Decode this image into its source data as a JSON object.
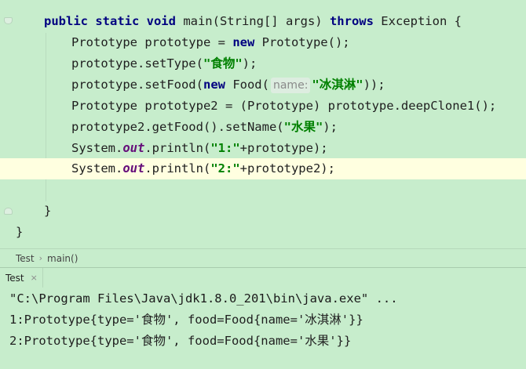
{
  "editor": {
    "lines": [
      {
        "parts": [
          {
            "t": "public static void",
            "c": "kw"
          },
          {
            "t": " main(String[] args) ",
            "c": ""
          },
          {
            "t": "throws",
            "c": "kw"
          },
          {
            "t": " Exception {",
            "c": ""
          }
        ]
      },
      {
        "parts": [
          {
            "t": "Prototype prototype = ",
            "c": ""
          },
          {
            "t": "new",
            "c": "kw"
          },
          {
            "t": " Prototype();",
            "c": ""
          }
        ]
      },
      {
        "parts": [
          {
            "t": "prototype.setType(",
            "c": ""
          },
          {
            "t": "\"食物\"",
            "c": "str"
          },
          {
            "t": ");",
            "c": ""
          }
        ]
      },
      {
        "parts": [
          {
            "t": "prototype.setFood(",
            "c": ""
          },
          {
            "t": "new",
            "c": "kw"
          },
          {
            "t": " Food(",
            "c": ""
          },
          {
            "t": "name:",
            "c": "hint"
          },
          {
            "t": "\"冰淇淋\"",
            "c": "str"
          },
          {
            "t": "));",
            "c": ""
          }
        ]
      },
      {
        "parts": [
          {
            "t": "Prototype prototype2 = (Prototype) prototype.deepClone1();",
            "c": ""
          }
        ]
      },
      {
        "parts": [
          {
            "t": "prototype2.getFood().setName(",
            "c": ""
          },
          {
            "t": "\"水果\"",
            "c": "str"
          },
          {
            "t": ");",
            "c": ""
          }
        ]
      },
      {
        "parts": [
          {
            "t": "System.",
            "c": ""
          },
          {
            "t": "out",
            "c": "static-field"
          },
          {
            "t": ".println(",
            "c": ""
          },
          {
            "t": "\"1:\"",
            "c": "str"
          },
          {
            "t": "+prototype);",
            "c": ""
          }
        ]
      },
      {
        "parts": [
          {
            "t": "System.",
            "c": ""
          },
          {
            "t": "out",
            "c": "static-field"
          },
          {
            "t": ".println(",
            "c": ""
          },
          {
            "t": "\"2:\"",
            "c": "str"
          },
          {
            "t": "+prototype2);",
            "c": ""
          }
        ]
      },
      {
        "parts": []
      },
      {
        "parts": [
          {
            "t": "}",
            "c": ""
          }
        ]
      },
      {
        "parts": [
          {
            "t": "}",
            "c": ""
          }
        ]
      }
    ]
  },
  "breadcrumb": {
    "class_name": "Test",
    "method_name": "main()"
  },
  "run_panel": {
    "tab_label": "Test",
    "close_symbol": "×"
  },
  "console": {
    "lines": [
      "\"C:\\Program Files\\Java\\jdk1.8.0_201\\bin\\java.exe\" ...",
      "1:Prototype{type='食物', food=Food{name='冰淇淋'}}",
      "2:Prototype{type='食物', food=Food{name='水果'}}"
    ]
  },
  "colors": {
    "background": "#C7EDCC",
    "current_line": "#FFFFE0",
    "keyword": "#000080",
    "string": "#008000",
    "static_field": "#660E7A"
  }
}
